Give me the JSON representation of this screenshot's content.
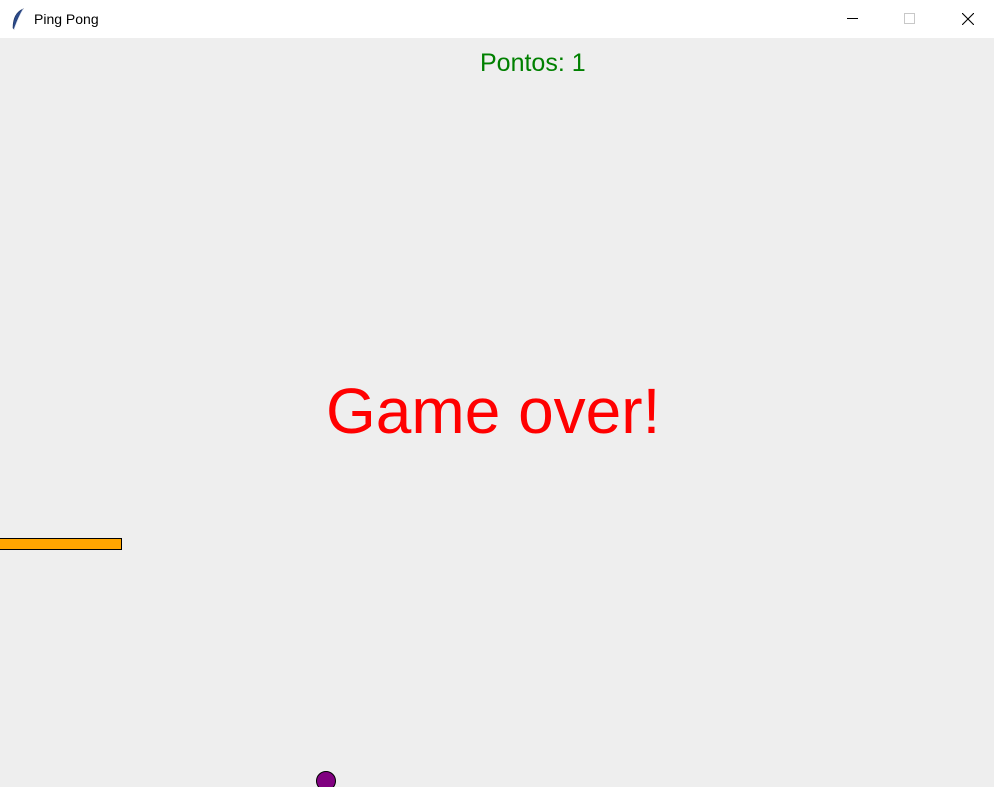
{
  "window": {
    "title": "Ping Pong",
    "icon": "feather-icon",
    "controls": [
      "minimize-icon",
      "maximize-icon",
      "close-icon"
    ]
  },
  "game": {
    "score_text": "Pontos: 1",
    "gameover_text": "Game over!",
    "colors": {
      "background": "#eeeeee",
      "score": "#008000",
      "gameover": "#ff0000",
      "paddle": "#ffa500",
      "ball": "#800080"
    }
  }
}
